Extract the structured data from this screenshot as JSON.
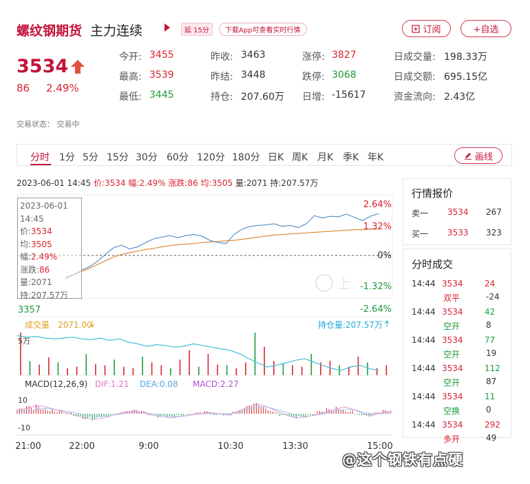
{
  "header": {
    "title": "螺纹钢期货",
    "subtitle": "主力连续",
    "delay_badge": "延 15分",
    "download_badge": "下载App可查看实时行情",
    "subscribe_label": "订阅",
    "watchlist_label": "+自选"
  },
  "quote": {
    "price": "3534",
    "change_abs": "86",
    "change_pct": "2.49%"
  },
  "stats": [
    {
      "label": "今开:",
      "value": "3455",
      "color": "red"
    },
    {
      "label": "昨收:",
      "value": "3463",
      "color": "dark"
    },
    {
      "label": "涨停:",
      "value": "3827",
      "color": "red"
    },
    {
      "label": "日成交量:",
      "value": "198.33万",
      "color": "dark"
    },
    {
      "label": "最高:",
      "value": "3539",
      "color": "red"
    },
    {
      "label": "昨结:",
      "value": "3448",
      "color": "dark"
    },
    {
      "label": "跌停:",
      "value": "3068",
      "color": "green"
    },
    {
      "label": "日成交额:",
      "value": "695.15亿",
      "color": "dark"
    },
    {
      "label": "最低:",
      "value": "3445",
      "color": "green"
    },
    {
      "label": "持仓:",
      "value": "207.60万",
      "color": "dark"
    },
    {
      "label": "日增:",
      "value": "-15617",
      "color": "dark"
    },
    {
      "label": "资金流向:",
      "value": "2.43亿",
      "color": "dark"
    }
  ],
  "trade_status": "交易状态：  交易中",
  "periods": [
    "分时",
    "1分",
    "5分",
    "15分",
    "30分",
    "60分",
    "120分",
    "180分",
    "日K",
    "周K",
    "月K",
    "季K",
    "年K"
  ],
  "draw_label": "画线",
  "info_line": {
    "datetime": "2023-06-01 14:45",
    "price": "价:3534",
    "amplitude": "幅:2.49%",
    "change": "涨跌:86",
    "average": "均:3505",
    "volume": "量:2071",
    "open_interest": "持:207.57万"
  },
  "tooltip": {
    "date": "2023-06-01",
    "time": "14:45",
    "price_label": "价:",
    "price": "3534",
    "avg_label": "均:",
    "avg": "3505",
    "amp_label": "幅:",
    "amp": "2.49%",
    "chg_label": "涨跌:",
    "chg": "86",
    "vol_label": "量:",
    "vol": "2071",
    "oi_label": "持:",
    "oi": "207.57万"
  },
  "chart_data": {
    "type": "line",
    "price_axis": {
      "left_bottom": "3357",
      "right_labels": [
        "2.64%",
        "1.32%",
        "0%",
        "-1.32%",
        "-2.64%"
      ]
    },
    "price_series": [
      3412,
      3420,
      3428,
      3435,
      3445,
      3458,
      3470,
      3475,
      3468,
      3472,
      3480,
      3487,
      3490,
      3493,
      3489,
      3493,
      3495,
      3492,
      3484,
      3480,
      3478,
      3495,
      3505,
      3510,
      3512,
      3513,
      3515,
      3510,
      3512,
      3508,
      3515,
      3530,
      3526,
      3529,
      3528,
      3533,
      3527,
      3521,
      3529,
      3534
    ],
    "avg_series": [
      3415,
      3420,
      3426,
      3432,
      3439,
      3446,
      3453,
      3458,
      3461,
      3464,
      3467,
      3469,
      3472,
      3474,
      3476,
      3477,
      3478,
      3480,
      3481,
      3482,
      3483,
      3484,
      3486,
      3488,
      3490,
      3492,
      3494,
      3495,
      3496,
      3497,
      3498,
      3499,
      3500,
      3501,
      3502,
      3503,
      3504,
      3504,
      3505,
      3505
    ],
    "x_labels": [
      "21:00",
      "22:00",
      "9:00",
      "10:30",
      "13:30",
      "15:00"
    ],
    "volume_label": "成交量",
    "volume_value": "2071.00",
    "oi_label": "持仓量:207.57万",
    "volume_axis": "5万",
    "volume_bars": [
      60,
      20,
      15,
      25,
      18,
      10,
      12,
      30,
      16,
      14,
      22,
      12,
      10,
      26,
      18,
      14,
      10,
      22,
      35,
      12,
      30,
      15,
      14,
      10,
      18,
      60,
      40,
      20,
      16,
      14,
      12,
      30,
      18,
      20,
      14,
      12,
      26,
      18,
      10,
      14
    ],
    "oi_series": [
      88,
      86,
      87,
      85,
      84,
      85,
      86,
      84,
      83,
      85,
      82,
      84,
      80,
      78,
      75,
      77,
      76,
      74,
      75,
      78,
      76,
      74,
      72,
      70,
      66,
      60,
      55,
      50,
      52,
      55,
      58,
      60,
      56,
      52,
      48,
      46,
      50,
      52,
      48,
      46
    ],
    "macd_label": "MACD(12,26,9)",
    "dif": "DIF:1.21",
    "dea": "DEA:0.08",
    "macd": "MACD:2.27",
    "macd_axis_top": "10",
    "macd_axis_bottom": "-10",
    "macd_bars": [
      4,
      6,
      7,
      5,
      3,
      1,
      -2,
      -4,
      -5,
      -3,
      -1,
      2,
      3,
      2,
      -1,
      -3,
      -4,
      -2,
      -1,
      1,
      2,
      -1,
      -2,
      3,
      6,
      8,
      5,
      2,
      -2,
      -4,
      -3,
      -1,
      2,
      4,
      6,
      3,
      -1,
      -2,
      1,
      3
    ],
    "dif_series": [
      2,
      4,
      6,
      5,
      3,
      1,
      -1,
      -3,
      -4,
      -3,
      -1,
      1,
      2,
      1,
      -1,
      -2,
      -3,
      -2,
      -1,
      0,
      1,
      0,
      -1,
      2,
      5,
      7,
      5,
      2,
      -1,
      -3,
      -2,
      -1,
      1,
      3,
      5,
      3,
      0,
      -1,
      1,
      2
    ],
    "dea_series": [
      1,
      2,
      3,
      4,
      3,
      2,
      1,
      -1,
      -2,
      -2,
      -1,
      0,
      1,
      1,
      0,
      -1,
      -2,
      -2,
      -1,
      0,
      0,
      0,
      0,
      1,
      3,
      5,
      5,
      3,
      1,
      -1,
      -2,
      -1,
      0,
      2,
      3,
      3,
      1,
      0,
      0,
      1
    ]
  },
  "quote_panel": {
    "title": "行情报价",
    "rows": [
      {
        "label": "卖一",
        "price": "3534",
        "volume": "267"
      },
      {
        "label": "买一",
        "price": "3533",
        "volume": "323"
      }
    ]
  },
  "deal_panel": {
    "title": "分时成交",
    "rows": [
      {
        "time": "14:44",
        "price": "3534",
        "qty": "24",
        "type": "双平",
        "delta": "-24",
        "type_color": "red"
      },
      {
        "time": "14:44",
        "price": "3534",
        "qty": "42",
        "type": "空开",
        "delta": "8",
        "type_color": "green"
      },
      {
        "time": "14:44",
        "price": "3534",
        "qty": "77",
        "type": "空开",
        "delta": "19",
        "type_color": "green"
      },
      {
        "time": "14:44",
        "price": "3534",
        "qty": "112",
        "type": "空开",
        "delta": "87",
        "type_color": "green"
      },
      {
        "time": "14:44",
        "price": "3534",
        "qty": "11",
        "type": "空换",
        "delta": "0",
        "type_color": "green"
      },
      {
        "time": "14:44",
        "price": "3534",
        "qty": "292",
        "type": "多开",
        "delta": "49",
        "type_color": "red"
      }
    ]
  },
  "chart_watermark": "上",
  "watermark": "@这个钢铁有点硬",
  "colors": {
    "brand": "#c4143a",
    "up": "#d8232c",
    "down": "#1e9a3a",
    "price_line": "#3a7fc0",
    "avg_line": "#e08a3a",
    "oi_line": "#3fbfd8"
  }
}
